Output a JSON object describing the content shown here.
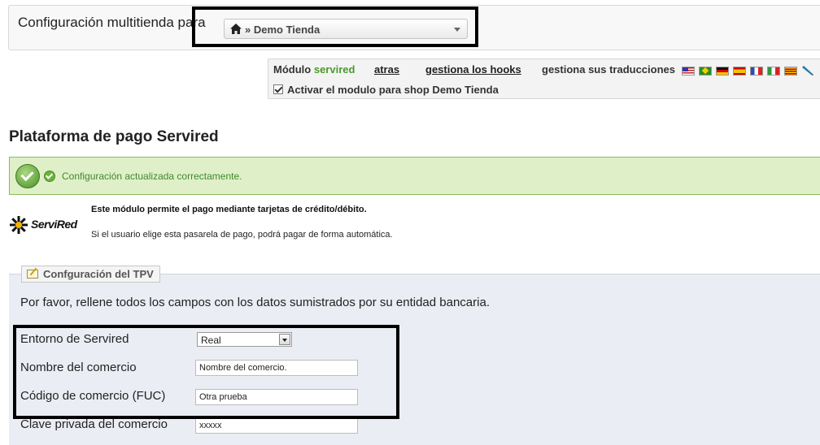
{
  "multishop": {
    "label": "Configuración multitienda para",
    "selected_shop": "» Demo Tienda",
    "home_icon": "home-icon"
  },
  "module_bar": {
    "module_prefix": "Módulo",
    "module_name": "servired",
    "back_link": "atras",
    "hooks_link": "gestiona los hooks",
    "translations_label": "gestiona sus traducciones",
    "flags": [
      "us-flag-icon",
      "br-flag-icon",
      "de-flag-icon",
      "es-flag-icon",
      "fr-flag-icon",
      "it-flag-icon",
      "ca-flag-icon",
      "pencil-icon"
    ],
    "activate_label": "Activar el modulo para shop Demo Tienda",
    "activate_checked": true
  },
  "page": {
    "heading": "Plataforma de pago Servired"
  },
  "success": {
    "message": "Configuración actualizada correctamente."
  },
  "intro": {
    "logo_text": "ServiRed",
    "line1": "Este módulo permite el pago mediante tarjetas de crédito/débito.",
    "line2": "Si el usuario elige esta pasarela de pago, podrá pagar de forma automática."
  },
  "tpv": {
    "legend": "Confguración del TPV",
    "instruction": "Por favor, rellene todos los campos con los datos sumistrados por su entidad bancaria.",
    "fields": {
      "environment": {
        "label": "Entorno de Servired",
        "value": "Real"
      },
      "merchant_name": {
        "label": "Nombre del comercio",
        "value": "Nombre del comercio."
      },
      "merchant_code": {
        "label": "Código de comercio (FUC)",
        "value": "Otra prueba"
      },
      "private_key": {
        "label": "Clave privada del comercio",
        "value": "xxxxx"
      }
    }
  },
  "colors": {
    "success_bg": "#dff0c8",
    "success_text": "#3f8a2a",
    "panel_bg": "#ebedf4",
    "module_name": "#4a9a2a"
  }
}
